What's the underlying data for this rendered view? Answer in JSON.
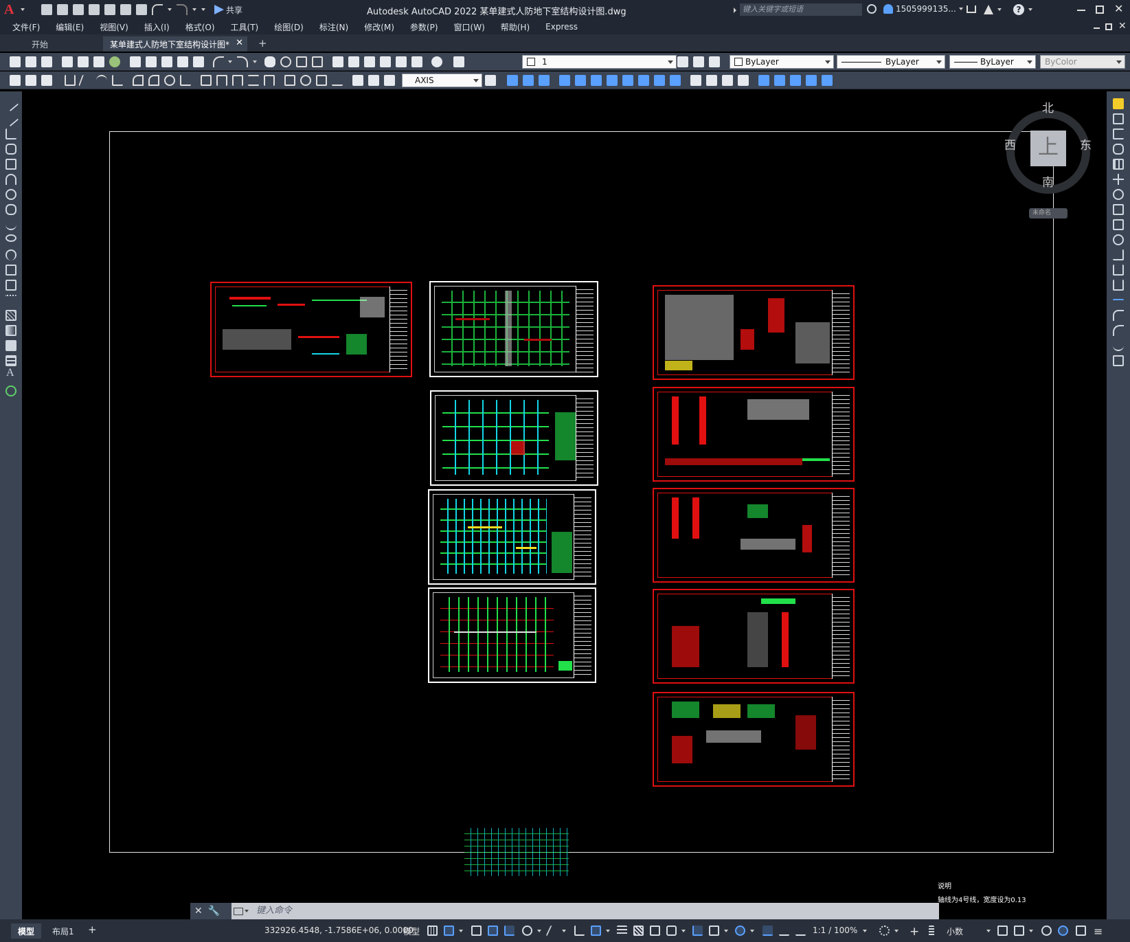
{
  "app": {
    "logo": "A",
    "title": "Autodesk AutoCAD 2022    某单建式人防地下室结构设计图.dwg",
    "share_label": "共享",
    "search_placeholder": "键入关键字或短语",
    "user_name": "1505999135..."
  },
  "menu": [
    "文件(F)",
    "编辑(E)",
    "视图(V)",
    "插入(I)",
    "格式(O)",
    "工具(T)",
    "绘图(D)",
    "标注(N)",
    "修改(M)",
    "参数(P)",
    "窗口(W)",
    "帮助(H)",
    "Express"
  ],
  "tabs": {
    "start": "开始",
    "document": "某单建式人防地下室结构设计图*",
    "add": "+"
  },
  "toolbar": {
    "layer_value": "1",
    "color_value": "ByLayer",
    "linetype_value": "ByLayer",
    "lineweight_value": "ByLayer",
    "plotstyle_value": "ByColor",
    "textstyle_value": "AXIS"
  },
  "viewcube": {
    "north": "北",
    "south": "南",
    "east": "东",
    "west": "西",
    "face": "上",
    "wcs": "未命名"
  },
  "drawing": {
    "note_line1": "说明",
    "note_line2": "轴线为4号线，宽度设为0.13"
  },
  "command_line": {
    "placeholder": "键入命令"
  },
  "status": {
    "tab_model": "模型",
    "tab_layout1": "布局1",
    "add_tab": "+",
    "coordinates": "332926.4548, -1.7586E+06, 0.0000",
    "space": "模型",
    "annotation_scale": "1:1 / 100%",
    "units": "小数"
  },
  "colors": {
    "titlebar": "#222833",
    "toolbar": "#3b4453",
    "canvas": "#000000",
    "frame_red": "#e01010",
    "line_green": "#22e04a",
    "line_cyan": "#13d6e8",
    "accent_blue": "#5aa0ff"
  }
}
